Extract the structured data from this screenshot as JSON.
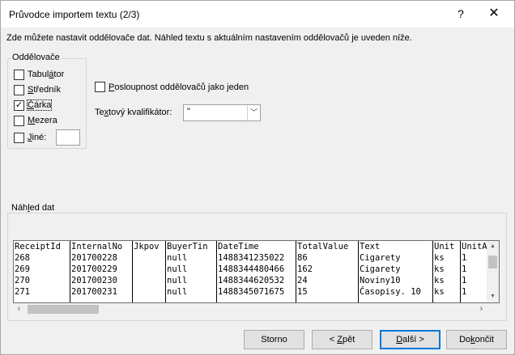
{
  "dialog": {
    "title": "Průvodce importem textu (2/3)",
    "help": "?",
    "close": "✕",
    "intro": "Zde můžete nastavit oddělovače dat. Náhled textu s aktuálním nastavením oddělovačů je uveden níže."
  },
  "delimiters": {
    "title": "Oddělovače",
    "tab": {
      "label_pre": "Tabul",
      "label_u": "á",
      "label_post": "tor",
      "checked": false
    },
    "semicolon": {
      "label_pre": "",
      "label_u": "S",
      "label_post": "tředník",
      "checked": false
    },
    "comma": {
      "label_pre": "",
      "label_u": "Č",
      "label_post": "árka",
      "checked": true
    },
    "space": {
      "label_pre": "",
      "label_u": "M",
      "label_post": "ezera",
      "checked": false
    },
    "other": {
      "label_pre": "",
      "label_u": "J",
      "label_post": "iné:",
      "checked": false,
      "value": ""
    }
  },
  "options": {
    "consecutive": {
      "label_pre": "",
      "label_u": "P",
      "label_post": "osloupnost oddělovačů jako jeden",
      "checked": false
    },
    "qualifier_label_pre": "Te",
    "qualifier_label_u": "x",
    "qualifier_label_post": "tový kvalifikátor:",
    "qualifier_value": "\""
  },
  "preview": {
    "title_pre": "Náh",
    "title_u": "l",
    "title_post": "ed dat",
    "columns": [
      {
        "header": "ReceiptId",
        "cells": [
          "268",
          "269",
          "270",
          "271"
        ]
      },
      {
        "header": "InternalNo",
        "cells": [
          "201700228",
          "201700229",
          "201700230",
          "201700231"
        ]
      },
      {
        "header": "Jkpov",
        "cells": [
          "",
          "",
          "",
          ""
        ]
      },
      {
        "header": "BuyerTin",
        "cells": [
          "null",
          "null",
          "null",
          "null"
        ]
      },
      {
        "header": "DateTime",
        "cells": [
          "1488341235022",
          "1488344480466",
          "1488344620532",
          "1488345071675"
        ]
      },
      {
        "header": "TotalValue",
        "cells": [
          "86",
          "162",
          "24",
          "15"
        ]
      },
      {
        "header": "Text",
        "cells": [
          "Cigarety",
          "Cigarety",
          "Noviny10",
          "Časopisy. 10"
        ]
      },
      {
        "header": "Unit",
        "cells": [
          "ks",
          "ks",
          "ks",
          "ks"
        ]
      },
      {
        "header": "UnitA",
        "cells": [
          "1",
          "1",
          "1",
          "1"
        ]
      }
    ]
  },
  "buttons": {
    "cancel": "Storno",
    "back_pre": "< ",
    "back_u": "Z",
    "back_post": "pět",
    "next_u": "D",
    "next_post": "alší >",
    "finish_pre": "Do",
    "finish_u": "k",
    "finish_post": "ončit"
  }
}
